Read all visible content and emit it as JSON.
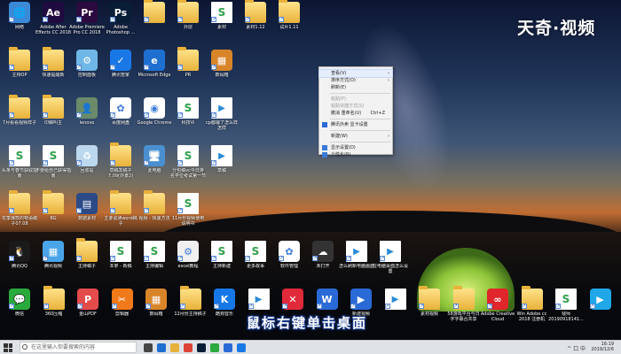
{
  "watermark": "天奇·视频",
  "subtitle": "鼠标右键单击桌面",
  "desktop_icons": [
    {
      "label": "网络",
      "kind": "app",
      "color": "#3a8ad8",
      "glyph": "🌐",
      "col": 0,
      "row": 0
    },
    {
      "label": "Adobe After Effects CC 2018",
      "kind": "app",
      "color": "#1f0b3f",
      "glyph": "Ae",
      "col": 1,
      "row": 0
    },
    {
      "label": "Adobe Premiere Pro CC 2018",
      "kind": "app",
      "color": "#2b0a3f",
      "glyph": "Pr",
      "col": 2,
      "row": 0
    },
    {
      "label": "Adobe Photoshop ...",
      "kind": "app",
      "color": "#081e36",
      "glyph": "Ps",
      "col": 3,
      "row": 0
    },
    {
      "label": "",
      "kind": "folder",
      "col": 4,
      "row": 0
    },
    {
      "label": "新建",
      "kind": "doc",
      "col": 4,
      "row": 0,
      "hidden": true
    },
    {
      "label": "外层",
      "kind": "folder",
      "col": 4,
      "row": 0
    },
    {
      "label": "素材",
      "kind": "doc",
      "col": 5,
      "row": 0
    },
    {
      "label": "素材1.12",
      "kind": "folder",
      "col": 6,
      "row": 0
    },
    {
      "label": "试片1.11",
      "kind": "folder",
      "col": 7,
      "row": 0
    },
    {
      "label": "主持OP",
      "kind": "folder",
      "col": 0,
      "row": 1
    },
    {
      "label": "快速提醒新",
      "kind": "folder",
      "col": 1,
      "row": 1
    },
    {
      "label": "控制面板",
      "kind": "app",
      "color": "#6fb7e6",
      "glyph": "⚙",
      "col": 2,
      "row": 1
    },
    {
      "label": "腾讯管家",
      "kind": "app",
      "color": "#1a78e6",
      "glyph": "✓",
      "col": 3,
      "row": 1
    },
    {
      "label": "Microsoft Edge",
      "kind": "app",
      "color": "#1f6fd0",
      "glyph": "e",
      "col": 4,
      "row": 1
    },
    {
      "label": "PR",
      "kind": "folder",
      "col": 5,
      "row": 1
    },
    {
      "label": "数码箱",
      "kind": "app",
      "color": "#d8852a",
      "glyph": "▦",
      "col": 6,
      "row": 1
    },
    {
      "label": "7月看看视频样子",
      "kind": "folder",
      "col": 0,
      "row": 2
    },
    {
      "label": "印鳞叫主",
      "kind": "folder",
      "col": 1,
      "row": 2
    },
    {
      "label": "lenovo",
      "kind": "app",
      "color": "#6a8a6a",
      "glyph": "👤",
      "col": 2,
      "row": 2
    },
    {
      "label": "百度网盘",
      "kind": "app",
      "color": "#ffffff",
      "glyph": "✿",
      "col": 3,
      "row": 2
    },
    {
      "label": "Google Chrome",
      "kind": "app",
      "color": "#ffffff",
      "glyph": "◉",
      "col": 4,
      "row": 2
    },
    {
      "label": "科技Vi",
      "kind": "doc",
      "col": 5,
      "row": 2
    },
    {
      "label": "cp都输了怎么样怎样",
      "kind": "vid",
      "col": 6,
      "row": 2
    },
    {
      "label": "头条号春节获取指南",
      "kind": "doc",
      "col": 0,
      "row": 3
    },
    {
      "label": "不要给自己获得指南",
      "kind": "doc",
      "col": 1,
      "row": 3
    },
    {
      "label": "回收站",
      "kind": "app",
      "color": "#bcd8ee",
      "glyph": "♻",
      "col": 2,
      "row": 3
    },
    {
      "label": "草稿发稿子7.09(外景2)",
      "kind": "folder",
      "col": 3,
      "row": 3
    },
    {
      "label": "此电脑",
      "kind": "app",
      "color": "#4a90d0",
      "glyph": "🖥",
      "col": 4,
      "row": 3
    },
    {
      "label": "分包稿vc今日排名学位考试第一节",
      "kind": "doc",
      "col": 5,
      "row": 3
    },
    {
      "label": "草稿",
      "kind": "vid",
      "col": 6,
      "row": 3
    },
    {
      "label": "花季爆款的物语稿子07.08",
      "kind": "folder",
      "col": 0,
      "row": 4
    },
    {
      "label": "BG",
      "kind": "folder",
      "col": 1,
      "row": 4
    },
    {
      "label": "数据素材",
      "kind": "app",
      "color": "#2b4a86",
      "glyph": "▤",
      "col": 2,
      "row": 4
    },
    {
      "label": "主要说通word稿子",
      "kind": "folder",
      "col": 3,
      "row": 4
    },
    {
      "label": "视频 - 快速方法",
      "kind": "folder",
      "col": 4,
      "row": 4
    },
    {
      "label": "11月份视频使用说明书",
      "kind": "doc",
      "col": 5,
      "row": 4
    },
    {
      "label": "腾讯QQ",
      "kind": "app",
      "color": "#1a1a1a",
      "glyph": "🐧",
      "col": 0,
      "row": 5
    },
    {
      "label": "腾讯视频",
      "kind": "app",
      "color": "#4aa4e8",
      "glyph": "▦",
      "col": 1,
      "row": 5
    },
    {
      "label": "主持稿子",
      "kind": "folder",
      "col": 2,
      "row": 5
    },
    {
      "label": "本拿 - 新稿",
      "kind": "doc",
      "col": 3,
      "row": 5
    },
    {
      "label": "主持编辑",
      "kind": "doc",
      "col": 4,
      "row": 5
    },
    {
      "label": "excel教程",
      "kind": "app",
      "color": "#f0f0f0",
      "glyph": "⚙",
      "col": 5,
      "row": 5
    },
    {
      "label": "主持新建",
      "kind": "doc",
      "col": 6,
      "row": 5
    },
    {
      "label": "更多故事",
      "kind": "doc",
      "col": 7,
      "row": 5
    },
    {
      "label": "软件管理",
      "kind": "app",
      "color": "#ffffff",
      "glyph": "✿",
      "col": 8,
      "row": 5
    },
    {
      "label": "未打开",
      "kind": "app",
      "color": "#333333",
      "glyph": "☁",
      "col": 9,
      "row": 5
    },
    {
      "label": "怎么刷新电脑画面",
      "kind": "vid",
      "col": 10,
      "row": 5
    },
    {
      "label": "在电脑桌面怎么设置",
      "kind": "vid",
      "col": 11,
      "row": 5
    },
    {
      "label": "微信",
      "kind": "app",
      "color": "#2aaa3c",
      "glyph": "💬",
      "col": 0,
      "row": 6
    },
    {
      "label": "360压缩",
      "kind": "folder",
      "col": 1,
      "row": 6
    },
    {
      "label": "金山PDF",
      "kind": "app",
      "color": "#e44b4b",
      "glyph": "P",
      "col": 2,
      "row": 6
    },
    {
      "label": "剪辑器",
      "kind": "app",
      "color": "#f07a1a",
      "glyph": "✂",
      "col": 3,
      "row": 6
    },
    {
      "label": "数码箱",
      "kind": "app",
      "color": "#d8852a",
      "glyph": "▦",
      "col": 4,
      "row": 6
    },
    {
      "label": "12月份主持稿子",
      "kind": "folder",
      "col": 5,
      "row": 6
    },
    {
      "label": "酷狗音乐",
      "kind": "app",
      "color": "#1677e6",
      "glyph": "K",
      "col": 6,
      "row": 6
    },
    {
      "label": "",
      "kind": "vid",
      "col": 7,
      "row": 6
    },
    {
      "label": "",
      "kind": "app",
      "color": "#e02a3a",
      "glyph": "✕",
      "col": 8,
      "row": 6
    },
    {
      "label": "",
      "kind": "app",
      "color": "#2a6ad6",
      "glyph": "W",
      "col": 9,
      "row": 6
    },
    {
      "label": "新建视频",
      "kind": "app",
      "color": "#2a6ad6",
      "glyph": "▶",
      "col": 10,
      "row": 6
    },
    {
      "label": "",
      "kind": "vid",
      "col": 11,
      "row": 6
    },
    {
      "label": "素材视频",
      "kind": "folder",
      "col": 12,
      "row": 6
    },
    {
      "label": "58游戏平台与日字字幕合共享",
      "kind": "folder",
      "col": 13,
      "row": 6
    },
    {
      "label": "Adobe Creative Cloud",
      "kind": "app",
      "color": "#e0262a",
      "glyph": "∞",
      "col": 14,
      "row": 6
    },
    {
      "label": "Win Adobe cc 2018 注册机",
      "kind": "folder",
      "col": 15,
      "row": 6
    },
    {
      "label": "钱师 20190918141...",
      "kind": "doc",
      "col": 16,
      "row": 6
    },
    {
      "label": "",
      "kind": "app",
      "color": "#1fa7e8",
      "glyph": "▶",
      "col": 17,
      "row": 6
    }
  ],
  "context_menu": {
    "items": [
      {
        "type": "item",
        "label": "查看(V)",
        "arrow": "›",
        "highlight": true
      },
      {
        "type": "item",
        "label": "排序方式(O)",
        "arrow": "›"
      },
      {
        "type": "item",
        "label": "刷新(E)"
      },
      {
        "type": "sep"
      },
      {
        "type": "item",
        "label": "粘贴(P)",
        "disabled": true
      },
      {
        "type": "item",
        "label": "粘贴快捷方式(S)",
        "disabled": true
      },
      {
        "type": "item",
        "label": "撤消 重命名(U)",
        "shortcut": "Ctrl+Z"
      },
      {
        "type": "sep"
      },
      {
        "type": "item",
        "label": "腾讯外卖 显卡设置",
        "icon_color": "#2a6ad6"
      },
      {
        "type": "sep"
      },
      {
        "type": "item",
        "label": "新建(W)",
        "arrow": "›"
      },
      {
        "type": "sep"
      },
      {
        "type": "item",
        "label": "显示设置(D)",
        "icon_color": "#3a7ad8"
      },
      {
        "type": "item",
        "label": "个性化(R)",
        "icon_color": "#3a7ad8"
      }
    ]
  },
  "taskbar": {
    "search_placeholder": "在这里输入你要搜索的内容",
    "apps": [
      {
        "name": "task-view-icon",
        "color": "#444444"
      },
      {
        "name": "edge-taskbar-icon",
        "color": "#1f6fd0"
      },
      {
        "name": "explorer-taskbar-icon",
        "color": "#e8b23a"
      },
      {
        "name": "chrome-taskbar-icon",
        "color": "#db4437"
      },
      {
        "name": "photoshop-taskbar-icon",
        "color": "#081e36"
      },
      {
        "name": "wechat-taskbar-icon",
        "color": "#2aaa3c"
      },
      {
        "name": "word-taskbar-icon",
        "color": "#2a6ad6"
      },
      {
        "name": "qq-taskbar-icon",
        "color": "#1a78e6"
      }
    ],
    "clock_time": "16:19",
    "clock_date": "2019/12/6",
    "tray_text": "^ 口 中"
  }
}
